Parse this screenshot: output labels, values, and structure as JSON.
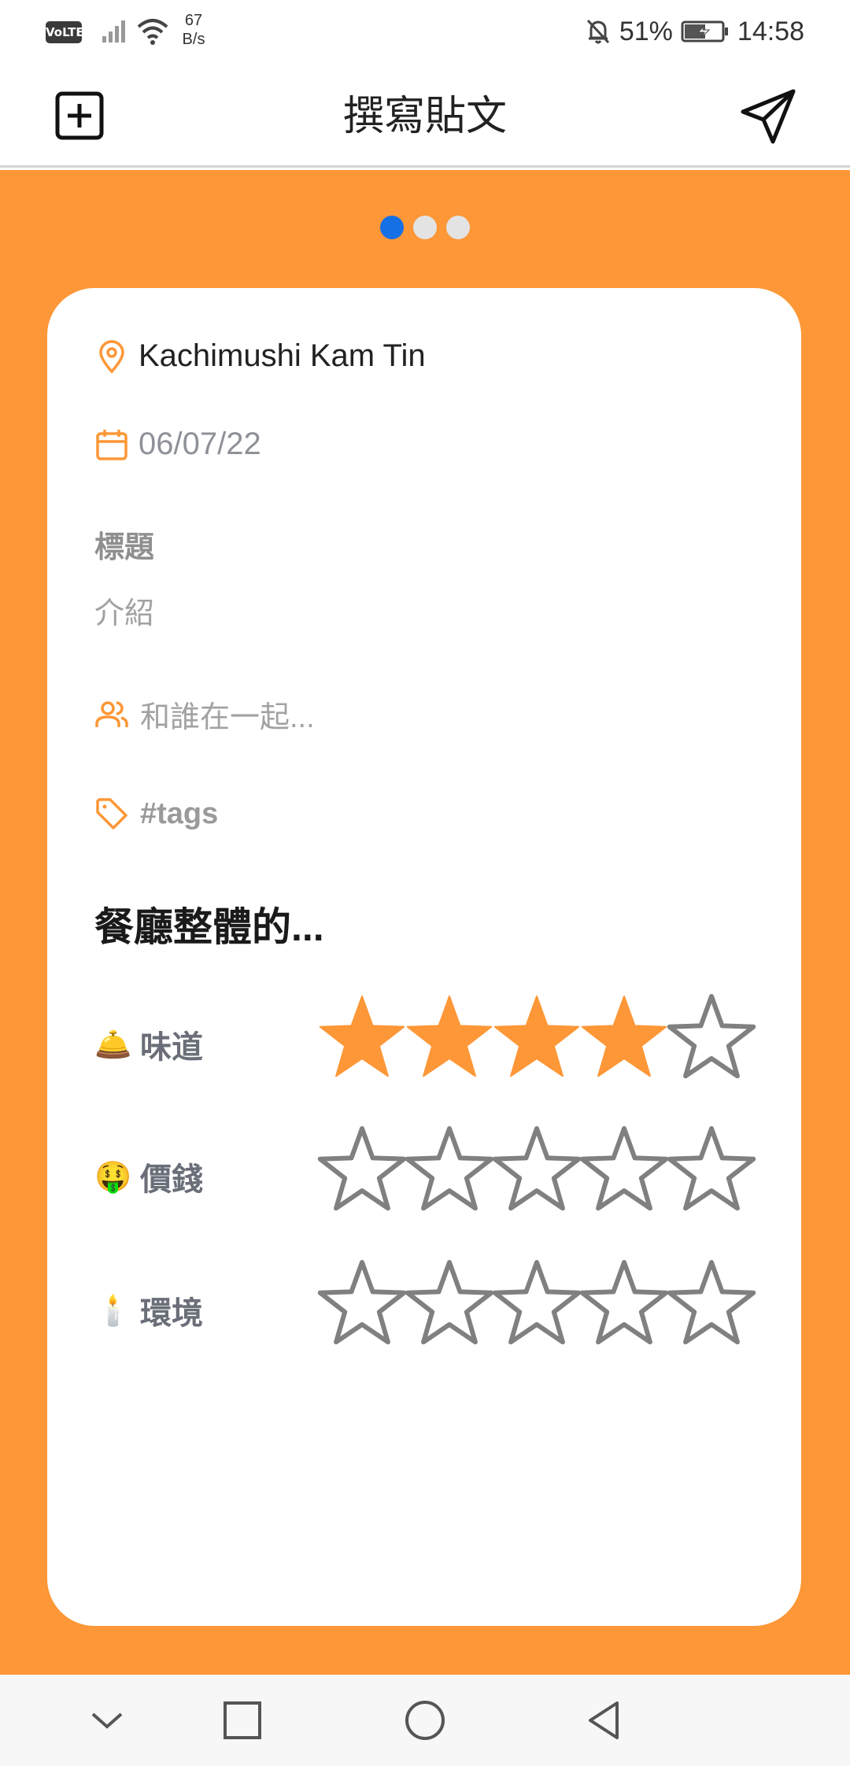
{
  "status_bar": {
    "volte": "VoLTE",
    "net_speed_value": "67",
    "net_speed_unit": "B/s",
    "battery_percent": "51%",
    "time": "14:58"
  },
  "header": {
    "title": "撰寫貼文",
    "add_icon": "plus-square-icon",
    "send_icon": "send-icon"
  },
  "pager": {
    "count": 3,
    "active_index": 0
  },
  "post": {
    "location": "Kachimushi Kam Tin",
    "date": "06/07/22",
    "title_placeholder": "標題",
    "intro_placeholder": "介紹",
    "with_placeholder": "和誰在一起...",
    "tags_placeholder": "#tags"
  },
  "ratings_section": {
    "title": "餐廳整體的...",
    "items": [
      {
        "emoji": "🛎️",
        "label": "味道",
        "rating": 4,
        "max": 5
      },
      {
        "emoji": "🤑",
        "label": "價錢",
        "rating": 0,
        "max": 5
      },
      {
        "emoji": "🕯️",
        "label": "環境",
        "rating": 0,
        "max": 5
      }
    ]
  },
  "colors": {
    "accent_orange": "#fd9737",
    "star_filled": "#fd9737",
    "star_empty_outline": "#808080",
    "pager_active": "#1570e6"
  }
}
